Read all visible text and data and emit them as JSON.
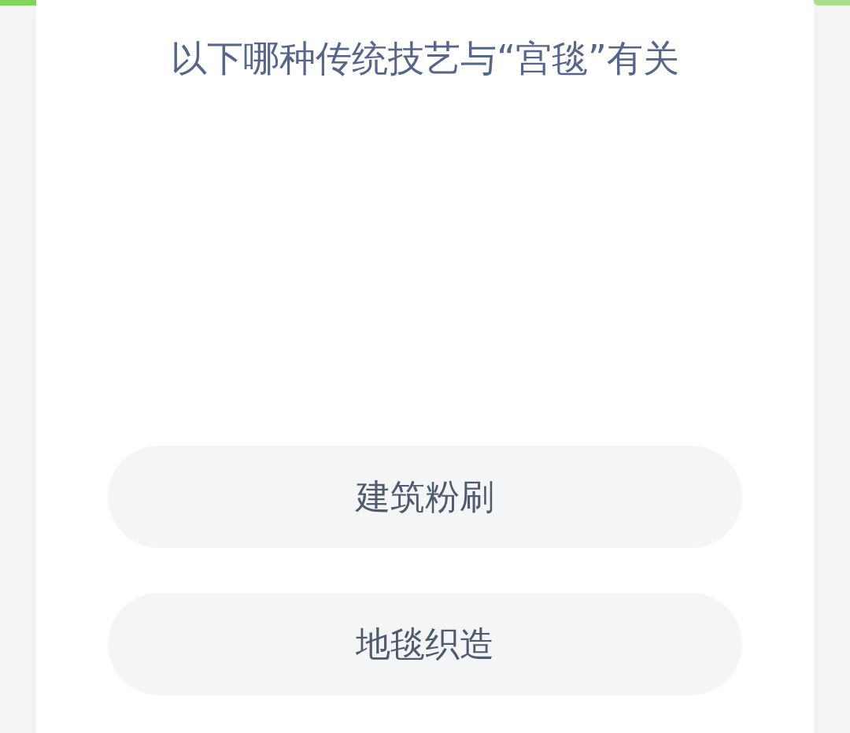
{
  "question": "以下哪种传统技艺与“宫毯”有关",
  "options": [
    {
      "label": "建筑粉刷"
    },
    {
      "label": "地毯织造"
    }
  ]
}
